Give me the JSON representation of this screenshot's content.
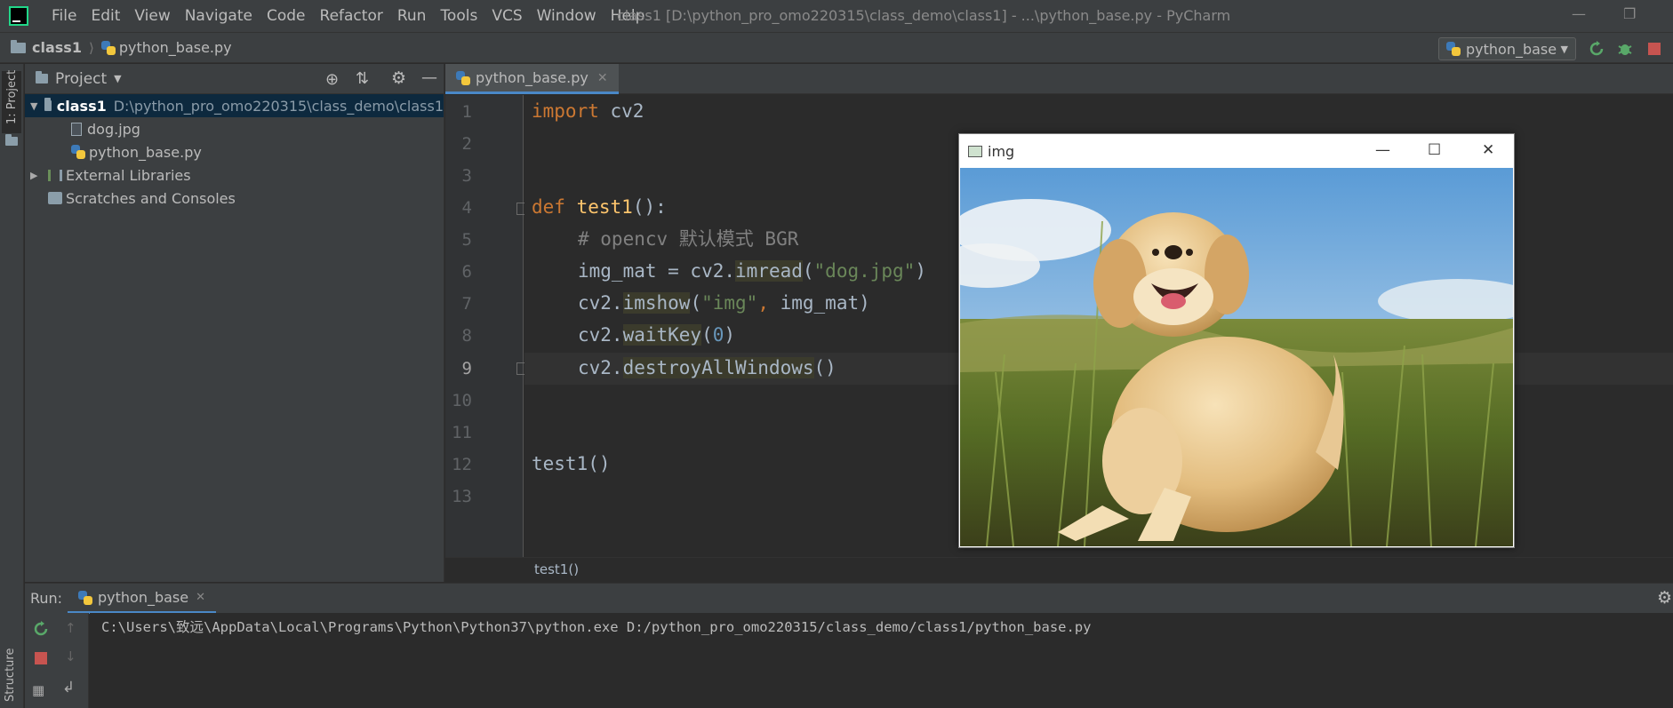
{
  "menubar": {
    "items": [
      "File",
      "Edit",
      "View",
      "Navigate",
      "Code",
      "Refactor",
      "Run",
      "Tools",
      "VCS",
      "Window",
      "Help"
    ],
    "window_title": "class1 [D:\\python_pro_omo220315\\class_demo\\class1] - ...\\python_base.py - PyCharm"
  },
  "navbar": {
    "crumb_project": "class1",
    "crumb_file": "python_base.py",
    "run_config": "python_base"
  },
  "left_strip": {
    "project_label": "1: Project",
    "structure_label": "Structure"
  },
  "project_panel": {
    "title": "Project",
    "root_name": "class1",
    "root_path": "D:\\python_pro_omo220315\\class_demo\\class1",
    "files": [
      "dog.jpg",
      "python_base.py"
    ],
    "external_libraries": "External Libraries",
    "scratches": "Scratches and Consoles"
  },
  "editor": {
    "tab_label": "python_base.py",
    "line_numbers": [
      "1",
      "2",
      "3",
      "4",
      "5",
      "6",
      "7",
      "8",
      "9",
      "10",
      "11",
      "12",
      "13"
    ],
    "code": {
      "l1_kw": "import",
      "l1_rest": " cv2",
      "l4_kw": "def",
      "l4_fn": "test1",
      "l4_rest": "():",
      "l5_cmt": "# opencv 默认模式 BGR",
      "l6_a": "img_mat = cv2.",
      "l6_fn": "imread",
      "l6_b": "(",
      "l6_str": "\"dog.jpg\"",
      "l6_c": ")",
      "l7_a": "cv2.",
      "l7_fn": "imshow",
      "l7_b": "(",
      "l7_str": "\"img\"",
      "l7_comma": ",",
      "l7_c": " img_mat)",
      "l8_a": "cv2.",
      "l8_fn": "waitKey",
      "l8_b": "(",
      "l8_num": "0",
      "l8_c": ")",
      "l9_a": "cv2.",
      "l9_fn": "destroyAllWindows",
      "l9_b": "()",
      "l12": "test1()"
    },
    "breadcrumb": "test1()"
  },
  "image_window": {
    "title": "img"
  },
  "run_panel": {
    "label": "Run:",
    "tab_label": "python_base",
    "command": "C:\\Users\\致远\\AppData\\Local\\Programs\\Python\\Python37\\python.exe D:/python_pro_omo220315/class_demo/class1/python_base.py"
  },
  "colors": {
    "accent_blue": "#4a88c7",
    "run_green": "#59a869",
    "stop_red": "#c75450",
    "keyword": "#cc7832",
    "function": "#ffc66d",
    "string": "#6a8759"
  }
}
